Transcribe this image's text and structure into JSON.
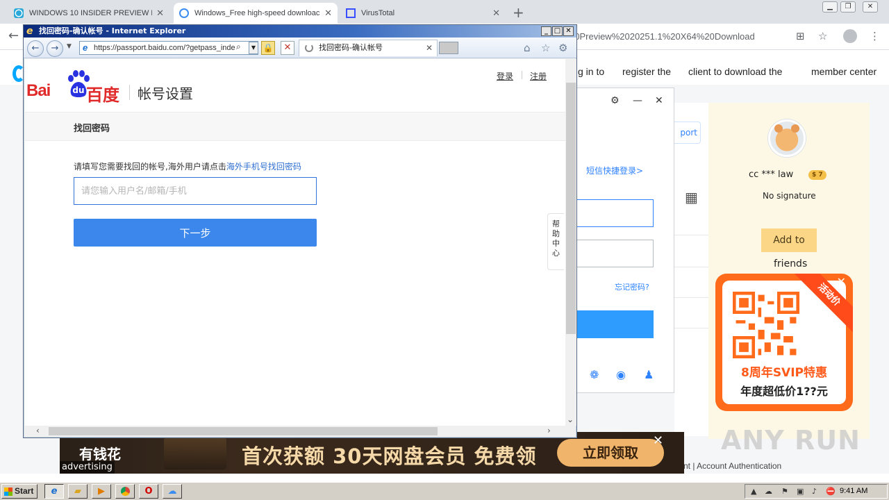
{
  "chrome": {
    "tabs": [
      {
        "title": "WINDOWS 10 INSIDER PREVIEW BU",
        "close": "✕"
      },
      {
        "title": "Windows_Free high-speed downloac",
        "close": "✕"
      },
      {
        "title": "VirusTotal",
        "close": "✕"
      }
    ],
    "new_tab": "+",
    "url_fragment": "20Preview%2020251.1%20X64%20Download"
  },
  "site": {
    "nav": [
      "g in to",
      "register the",
      "client to download the",
      "member center"
    ],
    "login_dialog": {
      "sms_login": "短信快捷登录>",
      "forgot_password": "忘记密码?"
    },
    "passport_fragment": "port",
    "profile": {
      "username": "cc *** law",
      "vip_level": "$ 7",
      "signature": "No signature",
      "add_button": "Add to",
      "friends": "friends"
    },
    "promo": {
      "ribbon": "活动价",
      "line1": "8周年SVIP特惠",
      "line2": "年度超低价1??元"
    },
    "watermark": "ANY RUN",
    "footer": "nt |   Account Authentication"
  },
  "ad": {
    "brand": "有钱花",
    "headline": "首次获额 30天网盘会员 免费领",
    "cta": "立即领取",
    "label": "advertising"
  },
  "ie": {
    "window_title": "找回密码-确认帐号 - Internet Explorer",
    "address": "https://passport.baidu.com/?getpass_inde",
    "tab_title": "找回密码-确认帐号"
  },
  "baidu": {
    "logo_bai": "Bai",
    "logo_du": "du",
    "logo_cn": "百度",
    "page_title": "帐号设置",
    "login_link": "登录",
    "register_link": "注册",
    "section_title": "找回密码",
    "instruction": "请填写您需要找回的帐号,海外用户请点击",
    "overseas_link": "海外手机号找回密码",
    "account_placeholder": "请您输入用户名/邮箱/手机",
    "next_button": "下一步",
    "help_center": "帮助中心"
  },
  "taskbar": {
    "start": "Start",
    "clock": "9:41 AM"
  }
}
